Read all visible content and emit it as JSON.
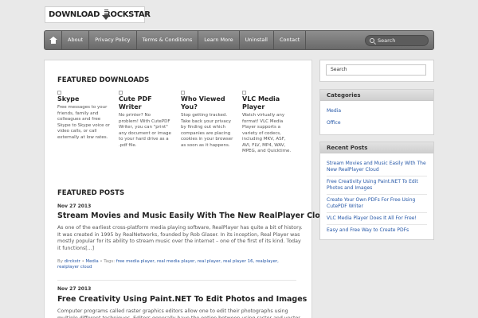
{
  "header": {
    "logo_left": "DOWNLOAD",
    "logo_right": "ROCKSTAR"
  },
  "nav": {
    "items": [
      "About",
      "Privacy Policy",
      "Terms & Conditions",
      "Learn More",
      "Uninstall",
      "Contact"
    ],
    "search_label": "Search"
  },
  "featured_downloads": {
    "title": "FEATURED DOWNLOADS",
    "items": [
      {
        "title": "Skype",
        "desc": "Free messages to your friends, family and colleagues and free Skype to Skype voice or video calls, or call externally at low rates."
      },
      {
        "title": "Cute PDF Writer",
        "desc": "No printer? No problem! With CutePDF Writer, you can \"print\" any document or image to your hard drive as a .pdf file."
      },
      {
        "title": "Who Viewed You?",
        "desc": "Stop getting tracked. Take back your privacy by finding out which companies are placing cookies in your browser as soon as it happens."
      },
      {
        "title": "VLC Media Player",
        "desc": "Watch virtually any format! VLC Media Player supports a variety of codecs, including MKV, ASF, AVI, FLV, MP4, WAV, MPEG, and Quicktime."
      }
    ]
  },
  "featured_posts": {
    "title": "FEATURED POSTS",
    "posts": [
      {
        "date": "Nov 27 2013",
        "title": "Stream Movies and Music Easily With The New RealPlayer Cloud",
        "excerpt": "As one of the earliest cross-platform media playing software, RealPlayer has quite a bit of history. It was created in 1995 by RealNetworks, founded by Rob Glaser. In its inception, Real Player was mostly popular for its ability to stream music over the internet – one of the first of its kind. Today it functions[...]",
        "meta_by": "By",
        "author": "dirckstr",
        "category": "Media",
        "tags_label": "Tags:",
        "tags": "free media player, real media player, real player, real player 16, realplayer, realplayer cloud"
      },
      {
        "date": "Nov 27 2013",
        "title": "Free Creativity Using Paint.NET To Edit Photos and Images",
        "excerpt": "Computer programs called raster graphics editors allow one to edit their photographs using multiple different techniques. Editors generally have the option between using raster and vector"
      }
    ]
  },
  "sidebar": {
    "search_label": "Search",
    "categories": {
      "title": "Categories",
      "items": [
        "Media",
        "Office"
      ]
    },
    "recent_posts": {
      "title": "Recent Posts",
      "items": [
        "Stream Movies and Music Easily With The New RealPlayer Cloud",
        "Free Creativity Using Paint.NET To Edit Photos and Images",
        "Create Your Own PDFs For Free Using CutePDF Writer",
        "VLC Media Player Does It All For Free!",
        "Easy and Free Way to Create PDFs"
      ]
    }
  },
  "colors": {
    "background": "#e9e9e9",
    "nav_bar": "#7a7a7a",
    "link": "#2557a7"
  }
}
